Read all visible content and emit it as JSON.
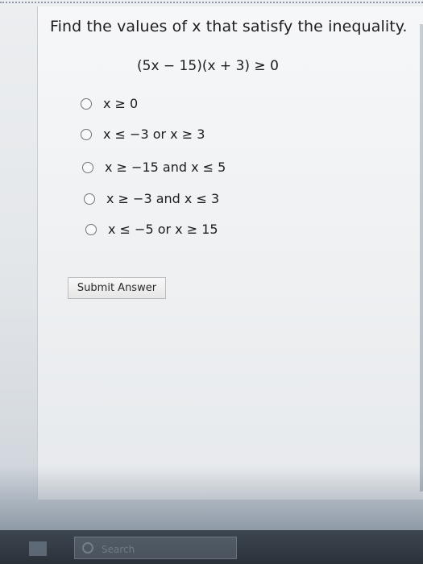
{
  "question": {
    "prompt": "Find the values of x that satisfy the inequality.",
    "inequality": "(5x − 15)(x + 3) ≥ 0"
  },
  "options": [
    {
      "label": "x ≥ 0",
      "selected": false
    },
    {
      "label": "x ≤ −3 or x ≥ 3",
      "selected": false
    },
    {
      "label": "x ≥ −15 and x ≤ 5",
      "selected": false
    },
    {
      "label": "x ≥ −3 and x ≤ 3",
      "selected": false
    },
    {
      "label": "x ≤ −5 or x ≥ 15",
      "selected": false
    }
  ],
  "submit": {
    "label": "Submit Answer"
  },
  "taskbar": {
    "start_icon": "windows-start-icon",
    "search_placeholder": "Search"
  },
  "colors": {
    "page_bg": "#eceef0",
    "text": "#1d1d1f",
    "radio_border": "#6f7479",
    "taskbar": "#2a3139"
  }
}
